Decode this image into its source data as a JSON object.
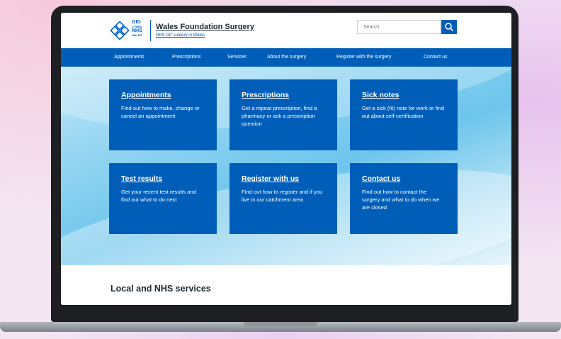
{
  "header": {
    "logo_line1": "GIG",
    "logo_line2": "CYMRU",
    "logo_line3": "NHS",
    "logo_line4": "WALES",
    "site_title": "Wales Foundation Surgery",
    "site_subtitle": "NHS GP surgery in Wales",
    "search_placeholder": "Search",
    "search_icon": "magnifier-icon"
  },
  "nav": {
    "items": [
      {
        "label": "Appointments"
      },
      {
        "label": "Prescriptions"
      },
      {
        "label": "Services"
      },
      {
        "label": "About the surgery"
      },
      {
        "label": "Register with the surgery"
      },
      {
        "label": "Contact us"
      }
    ]
  },
  "cards": [
    {
      "title": "Appointments",
      "text": "Find out how to make, change or cancel an appointment"
    },
    {
      "title": "Prescriptions",
      "text": "Get a repeat prescription, find a pharmacy or ask a prescription question"
    },
    {
      "title": "Sick notes",
      "text": "Get a sick (fit) note for work or find out about self-certification"
    },
    {
      "title": "Test results",
      "text": "Get your recent test results and find out what to do next"
    },
    {
      "title": "Register with us",
      "text": "Find out how to register and if you live in our catchment area"
    },
    {
      "title": "Contact us",
      "text": "Find out how to contact the surgery and what to do when we are closed"
    }
  ],
  "section": {
    "title": "Local and NHS services"
  },
  "colors": {
    "brand_blue": "#005eb8",
    "text_dark": "#212b32"
  }
}
